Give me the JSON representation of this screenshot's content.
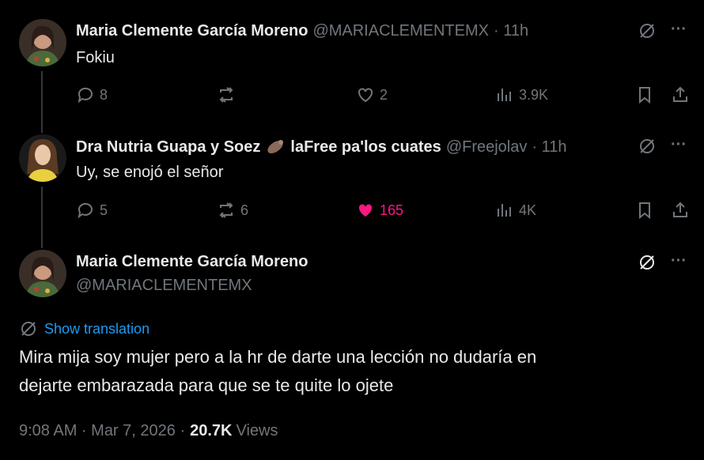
{
  "reply1": {
    "name": "Maria Clemente García Moreno",
    "handle": "@MARIACLEMENTEMX",
    "time": "· 11h",
    "text": "Fokiu",
    "replies": "8",
    "retweets": "",
    "likes": "2",
    "views": "3.9K"
  },
  "reply2": {
    "name": "Dra Nutria Guapa y Soez",
    "name_suffix": "laFree pa'los cuates",
    "handle": "@Freejolav",
    "time": "· 11h",
    "text": "Uy, se enojó el señor",
    "replies": "5",
    "retweets": "6",
    "likes": "165",
    "views": "4K"
  },
  "main": {
    "name": "Maria Clemente García Moreno",
    "handle": "@MARIACLEMENTEMX",
    "translate_label": "Show translation",
    "text_line1": "Mira mija soy mujer pero a la hr de darte una lección no dudaría en",
    "text_line2": "dejarte embarazada para que se te quite lo ojete",
    "timestamp": "9:08 AM · Mar 7, 2026 ·",
    "views_count": "20.7K",
    "views_label": "Views"
  },
  "more_label": "···",
  "colors": {
    "accent": "#1d9bf0",
    "like": "#f91880",
    "muted": "#71767b"
  }
}
